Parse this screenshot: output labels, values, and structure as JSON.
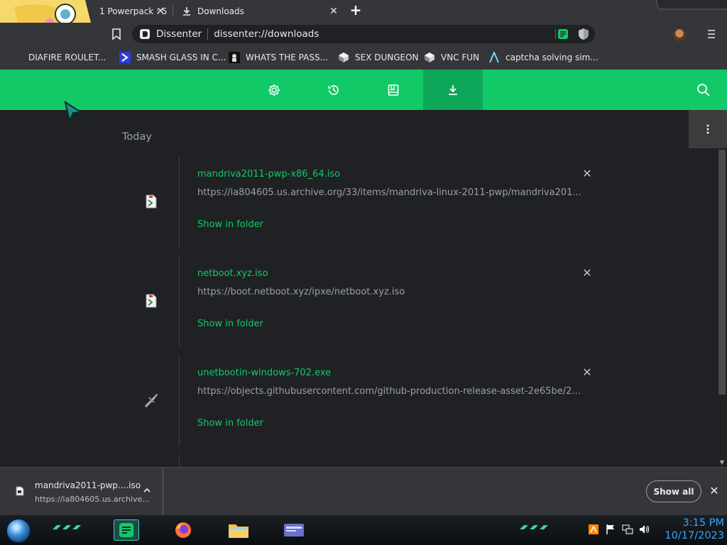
{
  "tabs": [
    {
      "title": "1 Powerpack : 5",
      "active": false
    },
    {
      "title": "Downloads",
      "active": true
    }
  ],
  "toolbar": {
    "site_name": "Dissenter",
    "url": "dissenter://downloads"
  },
  "bookmarks": [
    {
      "label": "DIAFIRE ROULET...",
      "icon": "bookmark-icon"
    },
    {
      "label": "SMASH GLASS IN C...",
      "icon": "chevron-icon"
    },
    {
      "label": "WHATS THE PASS...",
      "icon": "figure-icon"
    },
    {
      "label": "SEX DUNGEON",
      "icon": "cube-icon"
    },
    {
      "label": "VNC FUN",
      "icon": "cube-icon"
    },
    {
      "label": "captcha solving sim...",
      "icon": "a-logo-icon"
    }
  ],
  "downloads": {
    "date_heading": "Today",
    "show_in_folder": "Show in folder",
    "items": [
      {
        "name": "mandriva2011-pwp-x86_64.iso",
        "url": "https://ia804605.us.archive.org/33/items/mandriva-linux-2011-pwp/mandriva201...",
        "icon": "disc-file-icon"
      },
      {
        "name": "netboot.xyz.iso",
        "url": "https://boot.netboot.xyz/ipxe/netboot.xyz.iso",
        "icon": "disc-file-icon"
      },
      {
        "name": "unetbootin-windows-702.exe",
        "url": "https://objects.githubusercontent.com/github-production-release-asset-2e65be/2...",
        "icon": "program-icon"
      }
    ]
  },
  "shelf": {
    "file_name": "mandriva2011-pwp....iso",
    "file_url": "https://ia804605.us.archive...",
    "show_all": "Show all"
  },
  "taskbar": {
    "time": "3:15 PM",
    "date": "10/17/2023"
  },
  "colors": {
    "accent": "#12c967",
    "header_active": "#0ea659",
    "background": "#202124",
    "chrome": "#35363a",
    "clock": "#39a6ff"
  }
}
